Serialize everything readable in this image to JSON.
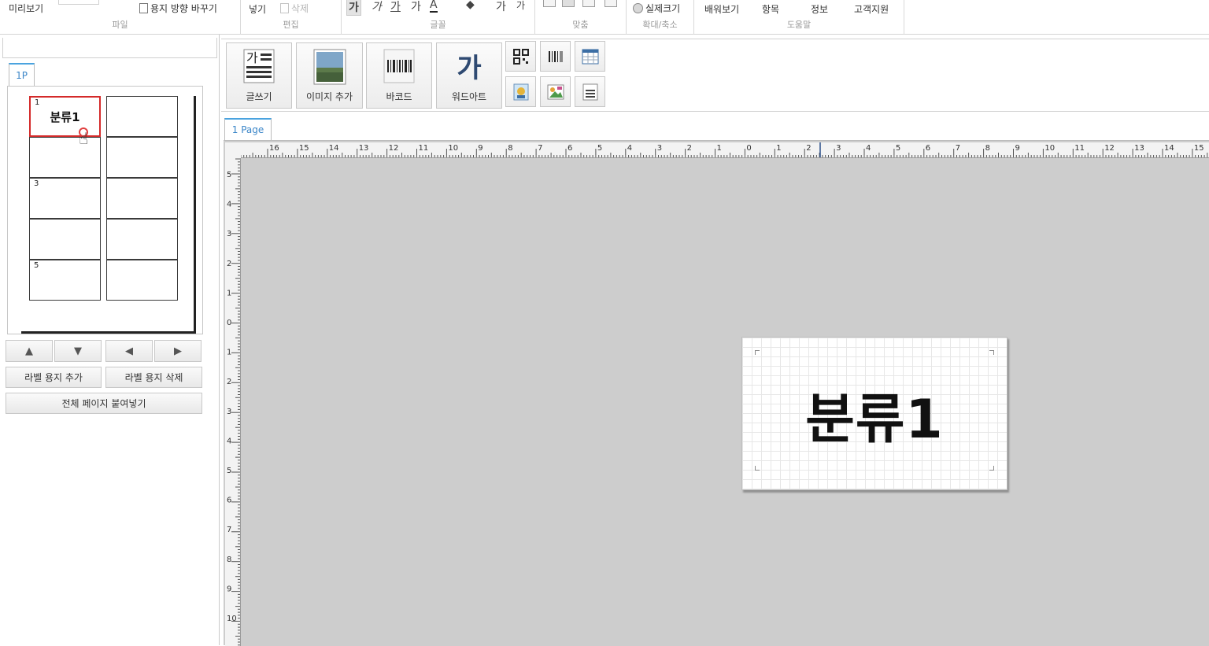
{
  "ribbon": {
    "groups": [
      {
        "label": "파일",
        "items": [
          "미리보기",
          "용지 방향 바꾸기"
        ]
      },
      {
        "label": "편집",
        "items": [
          "넣기",
          "삭제"
        ]
      },
      {
        "label": "글꼴",
        "items": [
          "가",
          "가",
          "가",
          "가",
          "가",
          "가"
        ]
      },
      {
        "label": "맞춤"
      },
      {
        "label": "확대/축소",
        "items": [
          "실제크기"
        ]
      },
      {
        "label": "도움말",
        "items": [
          "배워보기",
          "항목",
          "정보",
          "고객지원"
        ]
      }
    ]
  },
  "left_panel": {
    "page_tab": "1P",
    "cells": [
      {
        "num": "1",
        "text": "분류1"
      },
      {
        "num": "",
        "text": ""
      },
      {
        "num": "",
        "text": ""
      },
      {
        "num": "",
        "text": ""
      },
      {
        "num": "3",
        "text": ""
      },
      {
        "num": "",
        "text": ""
      },
      {
        "num": "",
        "text": ""
      },
      {
        "num": "",
        "text": ""
      },
      {
        "num": "5",
        "text": ""
      },
      {
        "num": "",
        "text": ""
      }
    ],
    "nav": {
      "up": "▲",
      "down": "▼",
      "left": "◀",
      "right": "▶"
    },
    "add_label": "라벨 용지 추가",
    "delete_label": "라벨 용지 삭제",
    "paste_all": "전체 페이지 붙여넣기"
  },
  "tools": {
    "write": "글쓰기",
    "write_glyph": "가",
    "add_image": "이미지 추가",
    "barcode": "바코드",
    "wordart": "워드아트",
    "wordart_glyph": "가"
  },
  "document": {
    "tab": "1 Page",
    "label_text": "분류1",
    "h_ruler_labels": [
      "16",
      "15",
      "14",
      "13",
      "12",
      "11",
      "10",
      "9",
      "8",
      "7",
      "6",
      "5",
      "4",
      "3",
      "2",
      "1",
      "0",
      "1",
      "2",
      "3",
      "4",
      "5",
      "6",
      "7",
      "8",
      "9",
      "10",
      "11",
      "12",
      "13",
      "14",
      "15"
    ],
    "v_ruler_labels": [
      "5",
      "4",
      "3",
      "2",
      "1",
      "0",
      "1",
      "2",
      "3",
      "4",
      "5",
      "6",
      "7",
      "8",
      "9",
      "10"
    ]
  },
  "colors": {
    "accent": "#4aa3df",
    "selection": "#d42a2a",
    "canvas": "#cdcdcd"
  }
}
